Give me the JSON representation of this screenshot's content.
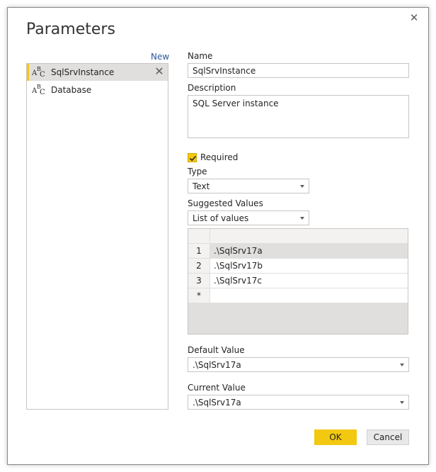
{
  "dialog": {
    "title": "Parameters",
    "new_label": "New",
    "close_glyph": "✕"
  },
  "parameters": [
    {
      "name": "SqlSrvInstance",
      "selected": true
    },
    {
      "name": "Database",
      "selected": false
    }
  ],
  "icons": {
    "type_icon": "abc-text-icon",
    "remove": "close-icon",
    "checkbox_check": "check-icon",
    "dropdown": "chevron-down-icon"
  },
  "form": {
    "name_label": "Name",
    "name_value": "SqlSrvInstance",
    "description_label": "Description",
    "description_value": "SQL Server instance",
    "required_label": "Required",
    "required_checked": true,
    "type_label": "Type",
    "type_value": "Text",
    "suggested_label": "Suggested Values",
    "suggested_value": "List of values",
    "values_table": {
      "rows": [
        {
          "num": "1",
          "value": ".\\SqlSrv17a"
        },
        {
          "num": "2",
          "value": ".\\SqlSrv17b"
        },
        {
          "num": "3",
          "value": ".\\SqlSrv17c"
        },
        {
          "num": "*",
          "value": ""
        }
      ]
    },
    "default_label": "Default Value",
    "default_value": ".\\SqlSrv17a",
    "current_label": "Current Value",
    "current_value": ".\\SqlSrv17a"
  },
  "buttons": {
    "ok": "OK",
    "cancel": "Cancel"
  },
  "colors": {
    "accent": "#f2c811",
    "link": "#2b579a",
    "selected_bg": "#e1dfdd"
  }
}
